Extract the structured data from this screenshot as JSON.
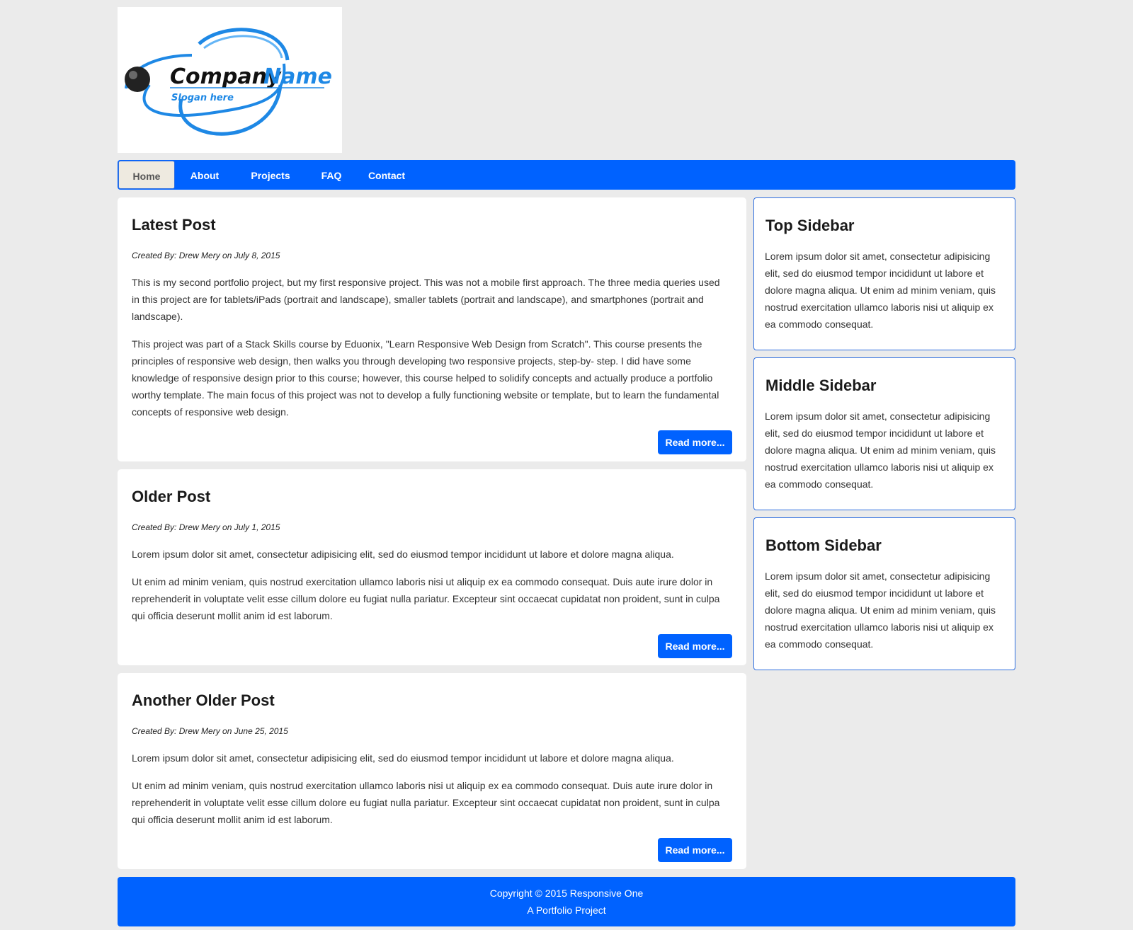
{
  "logo": {
    "company_word1": "Company",
    "company_word2": "Name",
    "slogan": "Slogan here",
    "colors": {
      "blue": "#1e88e5",
      "dark": "#111111"
    }
  },
  "nav": {
    "items": [
      {
        "label": "Home",
        "active": true
      },
      {
        "label": "About",
        "active": false
      },
      {
        "label": "Projects",
        "active": false
      },
      {
        "label": "FAQ",
        "active": false
      },
      {
        "label": "Contact",
        "active": false
      }
    ]
  },
  "posts": [
    {
      "title": "Latest Post",
      "meta": "Created By: Drew Mery on July 8, 2015",
      "paragraphs": [
        "This is my second portfolio project, but my first responsive project. This was not a mobile first approach. The three media queries used in this project are for tablets/iPads (portrait and landscape), smaller tablets (portrait and landscape), and smartphones (portrait and landscape).",
        "This project was part of a Stack Skills course by Eduonix, \"Learn Responsive Web Design from Scratch\". This course presents the principles of responsive web design, then walks you through developing two responsive projects, step-by- step. I did have some knowledge of responsive design prior to this course; however, this course helped to solidify concepts and actually produce a portfolio worthy template. The main focus of this project was not to develop a fully functioning website or template, but to learn the fundamental concepts of responsive web design."
      ],
      "button": "Read more..."
    },
    {
      "title": "Older Post",
      "meta": "Created By: Drew Mery on July 1, 2015",
      "paragraphs": [
        "Lorem ipsum dolor sit amet, consectetur adipisicing elit, sed do eiusmod tempor incididunt ut labore et dolore magna aliqua.",
        "Ut enim ad minim veniam, quis nostrud exercitation ullamco laboris nisi ut aliquip ex ea commodo consequat. Duis aute irure dolor in reprehenderit in voluptate velit esse cillum dolore eu fugiat nulla pariatur. Excepteur sint occaecat cupidatat non proident, sunt in culpa qui officia deserunt mollit anim id est laborum."
      ],
      "button": "Read more..."
    },
    {
      "title": "Another Older Post",
      "meta": "Created By: Drew Mery on June 25, 2015",
      "paragraphs": [
        "Lorem ipsum dolor sit amet, consectetur adipisicing elit, sed do eiusmod tempor incididunt ut labore et dolore magna aliqua.",
        "Ut enim ad minim veniam, quis nostrud exercitation ullamco laboris nisi ut aliquip ex ea commodo consequat. Duis aute irure dolor in reprehenderit in voluptate velit esse cillum dolore eu fugiat nulla pariatur. Excepteur sint occaecat cupidatat non proident, sunt in culpa qui officia deserunt mollit anim id est laborum."
      ],
      "button": "Read more..."
    }
  ],
  "sidebar": [
    {
      "title": "Top Sidebar",
      "text": "Lorem ipsum dolor sit amet, consectetur adipisicing elit, sed do eiusmod tempor incididunt ut labore et dolore magna aliqua. Ut enim ad minim veniam, quis nostrud exercitation ullamco laboris nisi ut aliquip ex ea commodo consequat."
    },
    {
      "title": "Middle Sidebar",
      "text": "Lorem ipsum dolor sit amet, consectetur adipisicing elit, sed do eiusmod tempor incididunt ut labore et dolore magna aliqua. Ut enim ad minim veniam, quis nostrud exercitation ullamco laboris nisi ut aliquip ex ea commodo consequat."
    },
    {
      "title": "Bottom Sidebar",
      "text": "Lorem ipsum dolor sit amet, consectetur adipisicing elit, sed do eiusmod tempor incididunt ut labore et dolore magna aliqua. Ut enim ad minim veniam, quis nostrud exercitation ullamco laboris nisi ut aliquip ex ea commodo consequat."
    }
  ],
  "footer": {
    "line1": "Copyright © 2015 Responsive One",
    "line2": "A Portfolio Project"
  },
  "colors": {
    "accent": "#0062ff",
    "background": "#ebebeb",
    "active_tab": "#eeeae0"
  }
}
